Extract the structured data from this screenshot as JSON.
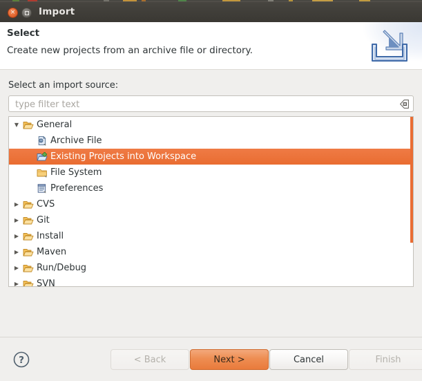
{
  "window": {
    "title": "Import",
    "close_label": "×",
    "maximize_label": "Maximize"
  },
  "header": {
    "title": "Select",
    "description": "Create new projects from an archive file or directory.",
    "banner_icon": "import-tray-arrow-icon"
  },
  "source_label": "Select an import source:",
  "filter": {
    "value": "",
    "placeholder": "type filter text",
    "clear_icon": "clear-field-icon"
  },
  "tree": {
    "items": [
      {
        "label": "General",
        "depth": 0,
        "expander": "▼",
        "icon": "folder-open-icon",
        "selected": false
      },
      {
        "label": "Archive File",
        "depth": 1,
        "expander": "",
        "icon": "archive-file-icon",
        "selected": false
      },
      {
        "label": "Existing Projects into Workspace",
        "depth": 1,
        "expander": "",
        "icon": "folder-import-icon",
        "selected": true
      },
      {
        "label": "File System",
        "depth": 1,
        "expander": "",
        "icon": "folder-closed-icon",
        "selected": false
      },
      {
        "label": "Preferences",
        "depth": 1,
        "expander": "",
        "icon": "preferences-document-icon",
        "selected": false
      },
      {
        "label": "CVS",
        "depth": 0,
        "expander": "▶",
        "icon": "folder-open-icon",
        "selected": false
      },
      {
        "label": "Git",
        "depth": 0,
        "expander": "▶",
        "icon": "folder-open-icon",
        "selected": false
      },
      {
        "label": "Install",
        "depth": 0,
        "expander": "▶",
        "icon": "folder-open-icon",
        "selected": false
      },
      {
        "label": "Maven",
        "depth": 0,
        "expander": "▶",
        "icon": "folder-open-icon",
        "selected": false
      },
      {
        "label": "Run/Debug",
        "depth": 0,
        "expander": "▶",
        "icon": "folder-open-icon",
        "selected": false
      },
      {
        "label": "SVN",
        "depth": 0,
        "expander": "▶",
        "icon": "folder-open-icon",
        "selected": false
      }
    ],
    "scrollbar": {
      "visible": true,
      "thumb_top_pct": 0,
      "thumb_height_pct": 74
    }
  },
  "footer": {
    "help_icon": "help-question-icon",
    "buttons": [
      {
        "label": "< Back",
        "state": "disabled"
      },
      {
        "label": "Next >",
        "state": "default"
      },
      {
        "label": "Cancel",
        "state": "normal"
      },
      {
        "label": "Finish",
        "state": "disabled"
      }
    ]
  },
  "colors": {
    "titlebar": "#403e39",
    "selection": "#e96c31",
    "accent": "#ea6d33",
    "dialog_bg": "#f0efed",
    "text": "#2e3436"
  }
}
